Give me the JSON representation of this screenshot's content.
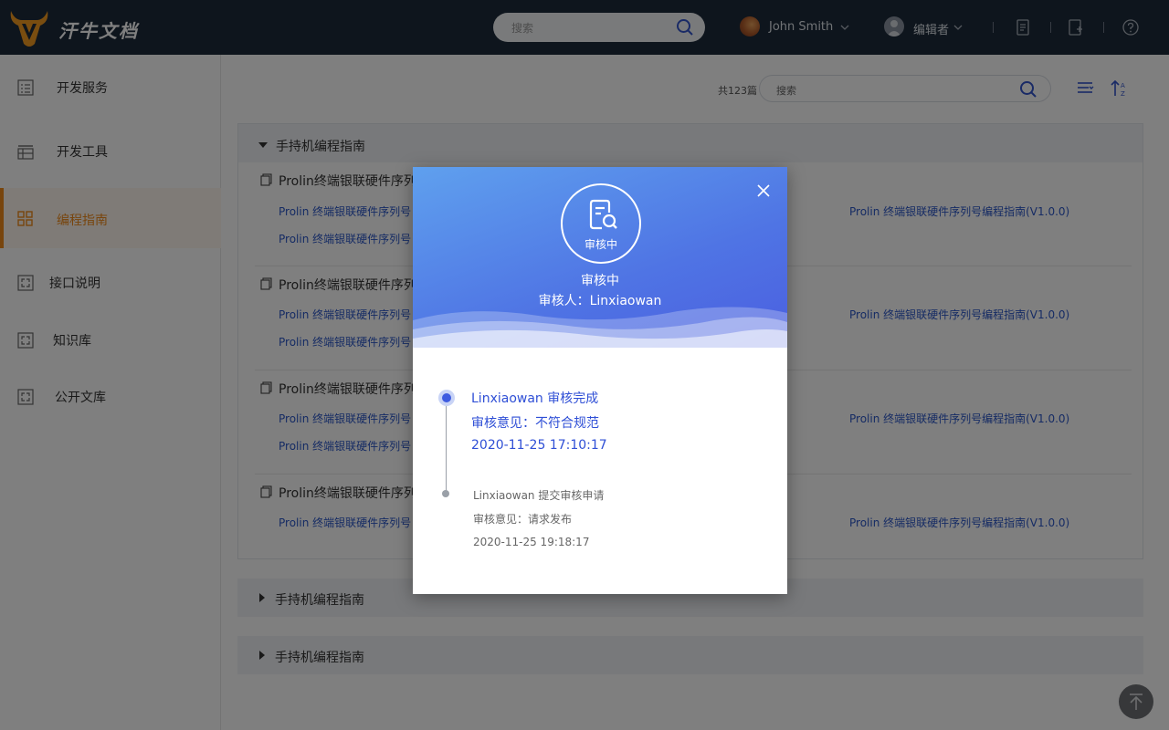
{
  "app": {
    "logo_text": "汗牛文档",
    "search_placeholder": "搜索",
    "user_name": "John Smith",
    "role_name": "编辑者"
  },
  "colors": {
    "accent": "#f08a1a",
    "link": "#2b56c8",
    "topbar": "#1d2a3a",
    "modal_header": "#4f74e4"
  },
  "sidebar": {
    "items": [
      {
        "label": "开发服务",
        "icon": "list-icon"
      },
      {
        "label": "开发工具",
        "icon": "table-icon"
      },
      {
        "label": "编程指南",
        "icon": "grid-icon",
        "active": true
      },
      {
        "label": "接口说明",
        "icon": "frame-icon"
      },
      {
        "label": "知识库",
        "icon": "frame-icon"
      },
      {
        "label": "公开文库",
        "icon": "frame-icon"
      }
    ]
  },
  "main": {
    "count_text": "共123篇",
    "search_placeholder": "搜索",
    "panel_title": "手持机编程指南",
    "groups": [
      {
        "title": "Prolin终端银联硬件序列",
        "link_left_1": "Prolin 终端银联硬件序列号",
        "link_left_2": "Prolin 终端银联硬件序列号",
        "link_right": "Prolin 终端银联硬件序列号编程指南(V1.0.0)"
      },
      {
        "title": "Prolin终端银联硬件序列",
        "link_left_1": "Prolin 终端银联硬件序列号",
        "link_left_2": "Prolin 终端银联硬件序列号",
        "link_right": "Prolin 终端银联硬件序列号编程指南(V1.0.0)"
      },
      {
        "title": "Prolin终端银联硬件序列",
        "link_left_1": "Prolin 终端银联硬件序列号",
        "link_left_2": "Prolin 终端银联硬件序列号",
        "link_right": "Prolin 终端银联硬件序列号编程指南(V1.0.0)"
      },
      {
        "title": "Prolin终端银联硬件序列",
        "link_left_1": "Prolin 终端银联硬件序列号",
        "link_left_2": "",
        "link_right": "Prolin 终端银联硬件序列号编程指南(V1.0.0)"
      }
    ],
    "collapsed_sections": [
      "手持机编程指南",
      "手持机编程指南"
    ]
  },
  "modal": {
    "badge_text": "审核中",
    "status": "审核中",
    "reviewer": "审核人：Linxiaowan",
    "timeline": [
      {
        "line1": "Linxiaowan   审核完成",
        "line2": "审核意见：不符合规范",
        "line3": "2020-11-25  17:10:17"
      },
      {
        "line1": "Linxiaowan   提交审核申请",
        "line2": "审核意见：请求发布",
        "line3": "2020-11-25  19:18:17"
      }
    ]
  }
}
